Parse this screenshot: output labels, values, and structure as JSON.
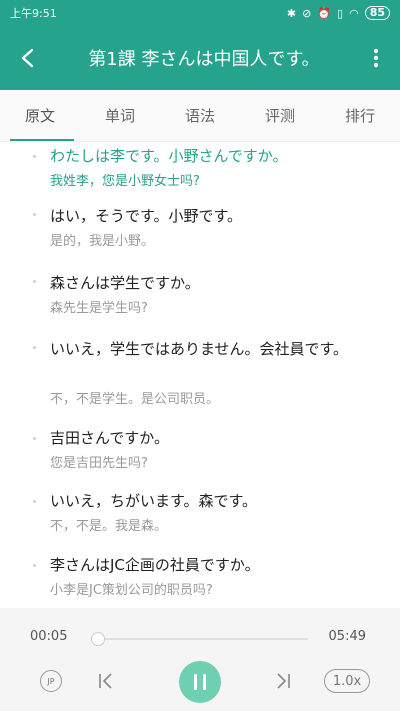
{
  "status_bar": {
    "time": "上午9:51",
    "icons": [
      "bluetooth-icon",
      "mute-icon",
      "alarm-icon",
      "vibrate-icon",
      "wifi-icon"
    ],
    "battery": "85"
  },
  "header": {
    "title": "第1課 李さんは中国人です。",
    "back_icon": "chevron-left-icon",
    "more_icon": "more-vertical-icon"
  },
  "tabs": [
    {
      "label": "原文",
      "active": true
    },
    {
      "label": "单词",
      "active": false
    },
    {
      "label": "语法",
      "active": false
    },
    {
      "label": "评测",
      "active": false
    },
    {
      "label": "排行",
      "active": false
    }
  ],
  "sentences": [
    {
      "jp": "わたしは李です。小野さんですか。",
      "zh": "我姓李，您是小野女士吗?",
      "current": true
    },
    {
      "jp": "はい，そうです。小野です。",
      "zh": "是的，我是小野。",
      "current": false
    },
    {
      "jp": "森さんは学生ですか。",
      "zh": "森先生是学生吗?",
      "current": false
    },
    {
      "jp": "いいえ，学生ではありません。会社員です。",
      "zh": "不，不是学生。是公司职员。",
      "current": false
    },
    {
      "jp": "吉田さんですか。",
      "zh": "您是吉田先生吗?",
      "current": false
    },
    {
      "jp": "いいえ，ちがいます。森です。",
      "zh": "不，不是。我是森。",
      "current": false
    },
    {
      "jp": "李さんはJC企画の社員ですか。",
      "zh": "小李是JC策划公司的职员吗?",
      "current": false
    }
  ],
  "player": {
    "current_time": "00:05",
    "total_time": "05:49",
    "progress": 0.014,
    "lang_toggle": "JP",
    "speed": "1.0x",
    "state": "playing"
  },
  "colors": {
    "accent": "#26a38c",
    "play_button": "#6fcfb1"
  }
}
